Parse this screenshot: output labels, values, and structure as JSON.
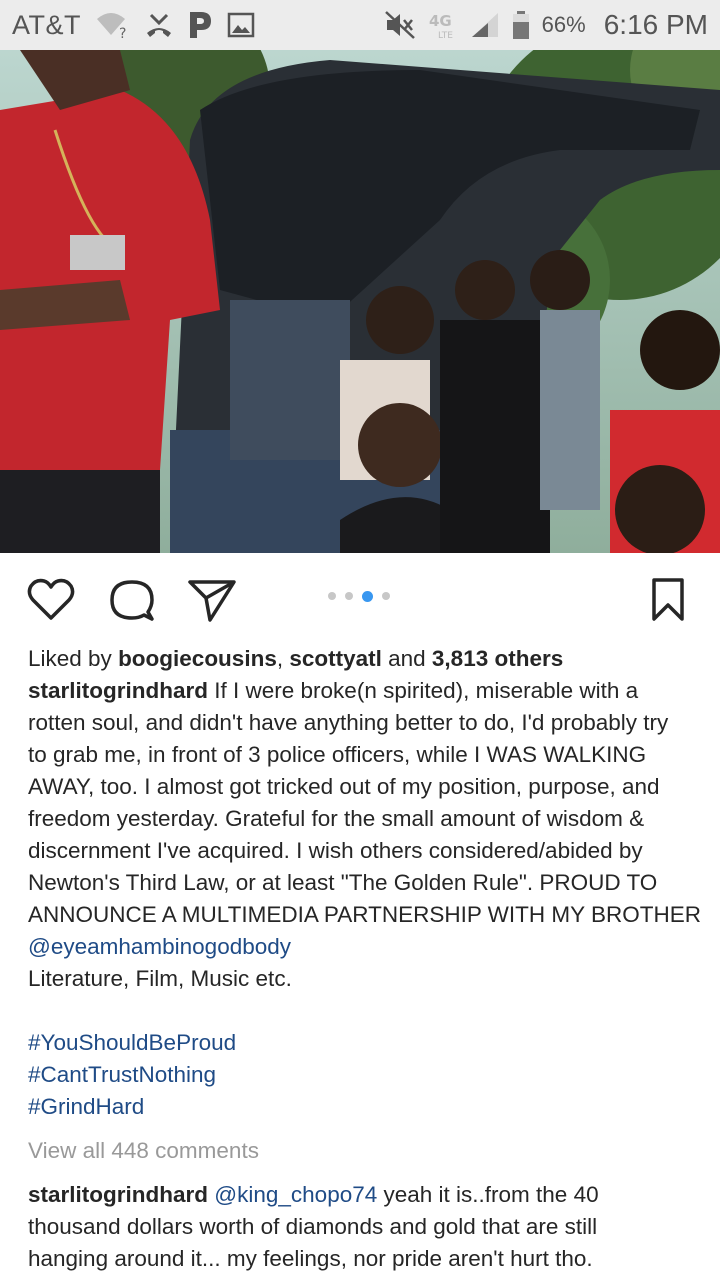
{
  "status_bar": {
    "carrier": "AT&T",
    "battery": "66%",
    "time": "6:16 PM",
    "icons": [
      "wifi-question-icon",
      "missed-call-icon",
      "pandora-icon",
      "image-icon",
      "muted-icon",
      "4g-lte-icon",
      "signal-icon",
      "battery-icon"
    ]
  },
  "post": {
    "carousel": {
      "count": 4,
      "active_index": 2
    },
    "actions": [
      "heart-icon",
      "comment-icon",
      "share-icon",
      "bookmark-icon"
    ],
    "likes": {
      "prefix": "Liked by ",
      "user1": "boogiecousins",
      "sep": ", ",
      "user2": "scottyatl",
      "and": " and ",
      "others": "3,813 others"
    },
    "caption": {
      "username": "starlitogrindhard",
      "lines": [
        " If I were broke(n spirited), miserable with a",
        "rotten soul, and didn't have anything better to do, I'd probably try",
        "to grab me, in front of 3 police officers, while I WAS WALKING",
        "AWAY, too. I almost got tricked out of my position, purpose, and",
        "freedom yesterday. Grateful for the small amount of wisdom &",
        "discernment  I've acquired. I wish others considered/abided by",
        "Newton's Third Law, or at least \"The Golden Rule\". PROUD TO",
        "ANNOUNCE A MULTIMEDIA PARTNERSHIP WITH MY BROTHER"
      ],
      "mention": "@eyeamhambinogodbody",
      "after_mention": "Literature, Film, Music etc.",
      "hashtags": [
        "#YouShouldBeProud",
        "#CantTrustNothing",
        "#GrindHard"
      ]
    },
    "view_comments": "View all 448 comments",
    "top_comment": {
      "username": "starlitogrindhard",
      "mention": "@king_chopo74",
      "lines": [
        " yeah it is..from the 40",
        "thousand dollars worth of diamonds and gold that are still",
        "hanging around it... my feelings, nor pride aren't hurt tho."
      ]
    }
  },
  "colors": {
    "status_bar_bg": "#ececec",
    "link": "#1f4b86",
    "muted": "#999999",
    "active_dot": "#3897f0"
  }
}
